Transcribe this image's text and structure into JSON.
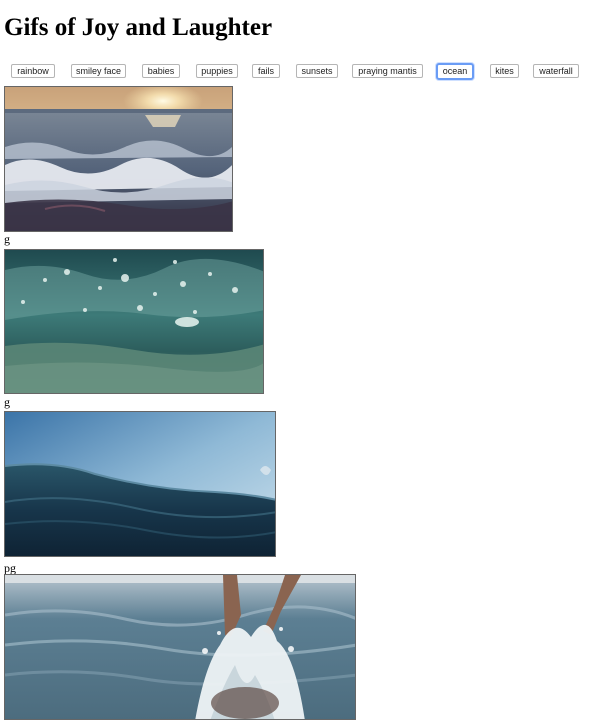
{
  "page": {
    "title": "Gifs of Joy and Laughter"
  },
  "topics": [
    {
      "label": "rainbow",
      "selected": false
    },
    {
      "label": "smiley face",
      "selected": false
    },
    {
      "label": "babies",
      "selected": false
    },
    {
      "label": "puppies",
      "selected": false
    },
    {
      "label": "fails",
      "selected": false
    },
    {
      "label": "sunsets",
      "selected": false
    },
    {
      "label": "praying mantis",
      "selected": false
    },
    {
      "label": "ocean",
      "selected": true
    },
    {
      "label": "kites",
      "selected": false
    },
    {
      "label": "waterfall",
      "selected": false
    }
  ],
  "results": [
    {
      "depicts": "ocean-sunset-waves",
      "caption": "g"
    },
    {
      "depicts": "underwater-surface",
      "caption": "g"
    },
    {
      "depicts": "ocean-wave-sky",
      "caption": "pg"
    },
    {
      "depicts": "legs-splashing-surf",
      "caption": ""
    }
  ],
  "colors": {
    "accent": "#6a9cf5"
  }
}
